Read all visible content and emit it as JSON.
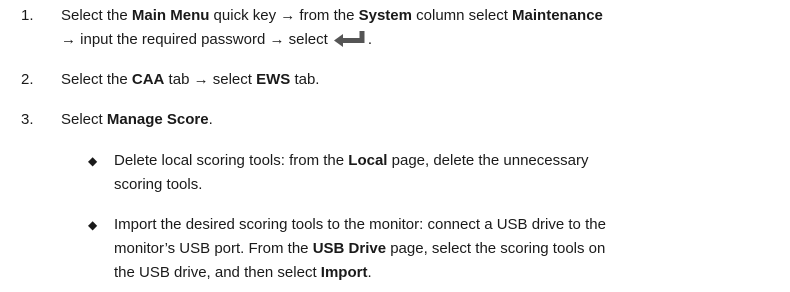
{
  "steps": [
    {
      "num": "1.",
      "line1": [
        "Select the ",
        "Main Menu",
        " quick key → from the ",
        "System",
        " column select ",
        "Maintenance"
      ],
      "line2": [
        "→ input the required password → select",
        "."
      ],
      "icon": "enter-key-icon"
    },
    {
      "num": "2.",
      "parts": [
        "Select the ",
        "CAA",
        " tab → select ",
        "EWS",
        " tab."
      ]
    },
    {
      "num": "3.",
      "parts": [
        "Select ",
        "Manage Score",
        "."
      ]
    }
  ],
  "bullets": [
    {
      "mark": "◆",
      "line1": [
        "Delete local scoring tools: from the ",
        "Local",
        " page, delete the unnecessary"
      ],
      "line2": "scoring tools."
    },
    {
      "mark": "◆",
      "line1": "Import the desired scoring tools to the monitor: connect a USB drive to the",
      "line2": [
        "monitor’s USB port. From the ",
        "USB Drive",
        " page, select the scoring tools on"
      ],
      "line3": [
        "the USB drive, and then select ",
        "Import",
        "."
      ]
    }
  ],
  "colors": {
    "text": "#1a1a1a",
    "icon": "#555555"
  }
}
